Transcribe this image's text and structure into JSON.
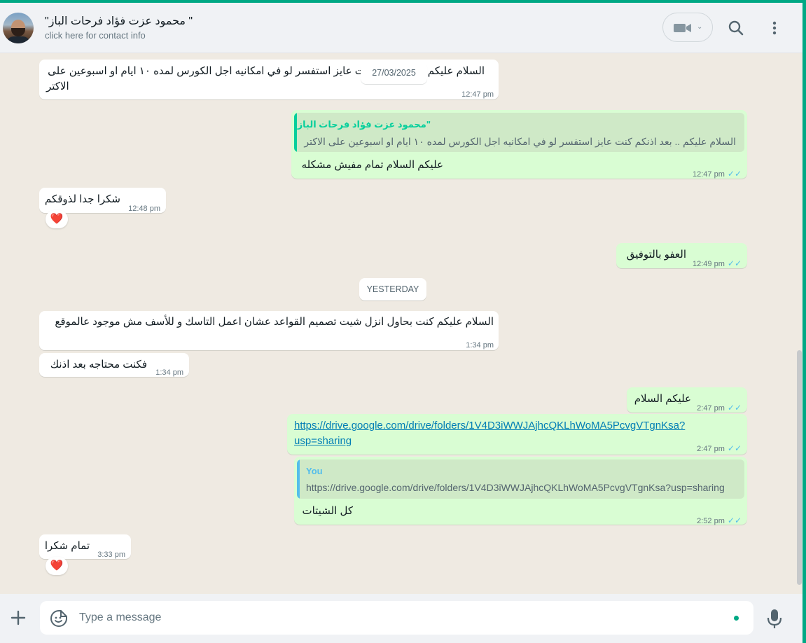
{
  "header": {
    "contact_name": "\"محمود عزت فؤاد فرحات الباز \"",
    "contact_sub": "click here for contact info"
  },
  "floating_date": "27/03/2025",
  "messages": {
    "m1": {
      "text_line1": "السلام عليكم .. بعد اذنكم كنت عايز استفسر لو في امكانيه اجل الكورس لمده ١٠ ايام او اسبوعين على",
      "text_line2": "الاكتر",
      "time": "12:47 pm"
    },
    "m2": {
      "quote_author": "\"محمود عزت فؤاد فرحات الباز",
      "quote_text": "السلام عليكم .. بعد اذنكم كنت عايز استفسر لو في امكانيه اجل الكورس لمده ١٠ ايام او اسبوعين على الاكتر",
      "text": "عليكم السلام تمام مفيش مشكله",
      "time": "12:47 pm"
    },
    "m3": {
      "text": "شكرا جدا لذوقكم",
      "time": "12:48 pm",
      "reaction": "❤️"
    },
    "m4": {
      "text": "العفو بالتوفيق",
      "time": "12:49 pm"
    },
    "m5": {
      "text": "السلام عليكم كنت بحاول انزل شيت تصميم القواعد عشان اعمل التاسك و للأسف مش موجود عالموقع",
      "time": "1:34 pm"
    },
    "m6": {
      "text": "فكنت محتاجه بعد اذنك",
      "time": "1:34 pm"
    },
    "m7": {
      "text": "عليكم السلام",
      "time": "2:47 pm"
    },
    "m8": {
      "link_line1": "https://drive.google.com/drive/folders/1V4D3iWWJAjhcQKLhWoMA5PcvgVTgnKsa?",
      "link_line2": "usp=sharing",
      "time": "2:47 pm"
    },
    "m9": {
      "quote_author": "You",
      "quote_text": "https://drive.google.com/drive/folders/1V4D3iWWJAjhcQKLhWoMA5PcvgVTgnKsa?usp=sharing",
      "text": "كل الشيتات",
      "time": "2:52 pm"
    },
    "m10": {
      "text": "تمام شكرا",
      "time": "3:33 pm",
      "reaction": "❤️"
    }
  },
  "date_divider": "YESTERDAY",
  "footer": {
    "placeholder": "Type a message"
  },
  "colors": {
    "accent": "#00a884",
    "outgoing_bubble": "#d9fdd3",
    "incoming_bubble": "#ffffff",
    "read_ticks": "#53bdeb"
  },
  "icons": [
    "video-call-icon",
    "search-icon",
    "menu-icon",
    "plus-icon",
    "emoji-icon",
    "mic-icon",
    "heart-reaction-icon",
    "double-check-icon"
  ]
}
